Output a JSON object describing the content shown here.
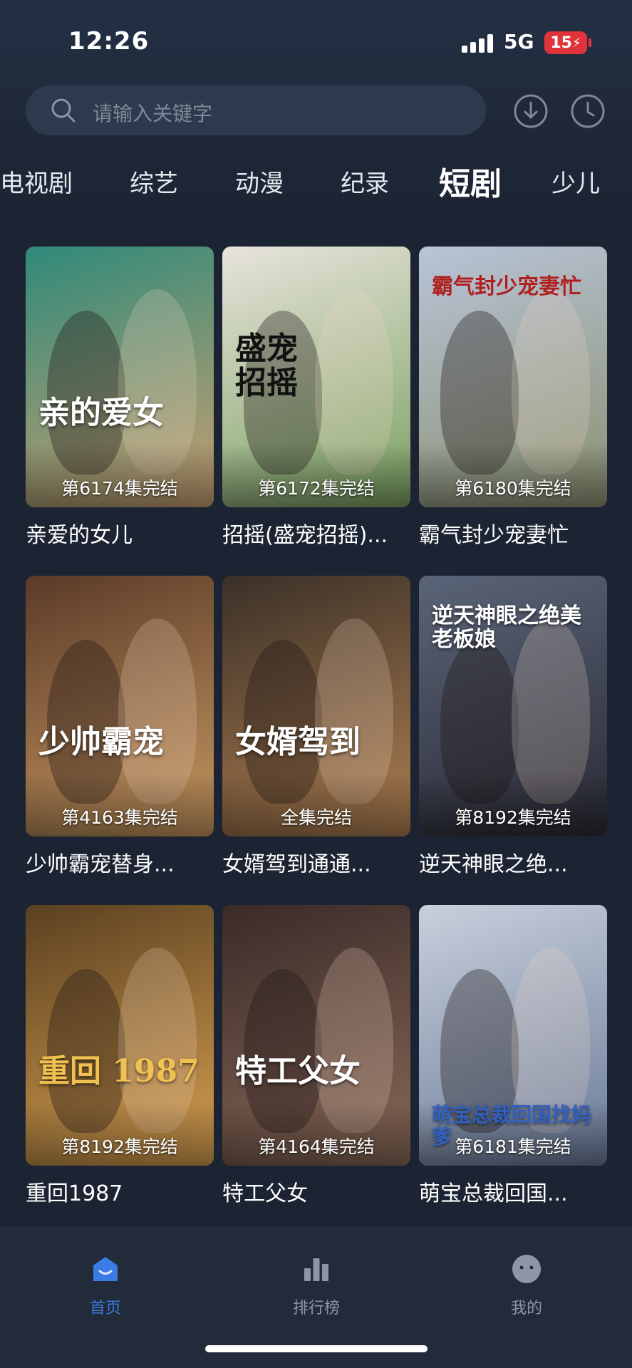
{
  "status_bar": {
    "time": "12:26",
    "network": "5G",
    "battery": "15"
  },
  "search": {
    "placeholder": "请输入关键字"
  },
  "tabs": [
    {
      "label": "电视剧"
    },
    {
      "label": "综艺"
    },
    {
      "label": "动漫"
    },
    {
      "label": "纪录"
    },
    {
      "label": "短剧",
      "active": true
    },
    {
      "label": "少儿"
    }
  ],
  "dramas": [
    {
      "title": "亲爱的女儿",
      "episodes": "第6174集完结",
      "poster_text": "亲的爱女",
      "colors": [
        "#2f8a7a",
        "#c8a070"
      ]
    },
    {
      "title": "招摇(盛宠招摇)...",
      "episodes": "第6172集完结",
      "poster_text": "盛宠招摇",
      "colors": [
        "#e8e4dc",
        "#7aa060"
      ]
    },
    {
      "title": "霸气封少宠妻忙",
      "episodes": "第6180集完结",
      "poster_text": "霸气封少宠妻忙",
      "colors": [
        "#b8c4d8",
        "#8a9070"
      ]
    },
    {
      "title": "少帅霸宠替身...",
      "episodes": "第4163集完结",
      "poster_text": "少帅霸宠",
      "colors": [
        "#5a3a28",
        "#c89860"
      ]
    },
    {
      "title": "女婿驾到通通...",
      "episodes": "全集完结",
      "poster_text": "女婿驾到",
      "colors": [
        "#3a3028",
        "#b08050"
      ]
    },
    {
      "title": "逆天神眼之绝...",
      "episodes": "第8192集完结",
      "poster_text": "逆天神眼之绝美老板娘",
      "colors": [
        "#5a6478",
        "#2a2a34"
      ]
    },
    {
      "title": "重回1987",
      "episodes": "第8192集完结",
      "poster_text": "重回 1987",
      "colors": [
        "#5a4020",
        "#d8a050"
      ]
    },
    {
      "title": "特工父女",
      "episodes": "第4164集完结",
      "poster_text": "特工父女",
      "colors": [
        "#3a2a28",
        "#8a6a58"
      ]
    },
    {
      "title": "萌宝总裁回国...",
      "episodes": "第6181集完结",
      "poster_text": "萌宝总裁回国找妈爹",
      "colors": [
        "#c8d0dc",
        "#6a7a98"
      ]
    }
  ],
  "bottom_nav": [
    {
      "label": "首页",
      "icon": "home-icon",
      "active": true
    },
    {
      "label": "排行榜",
      "icon": "ranking-icon"
    },
    {
      "label": "我的",
      "icon": "profile-icon"
    }
  ],
  "colors": {
    "accent": "#3b7be5",
    "background": "#1c2433",
    "battery": "#e0333a"
  }
}
